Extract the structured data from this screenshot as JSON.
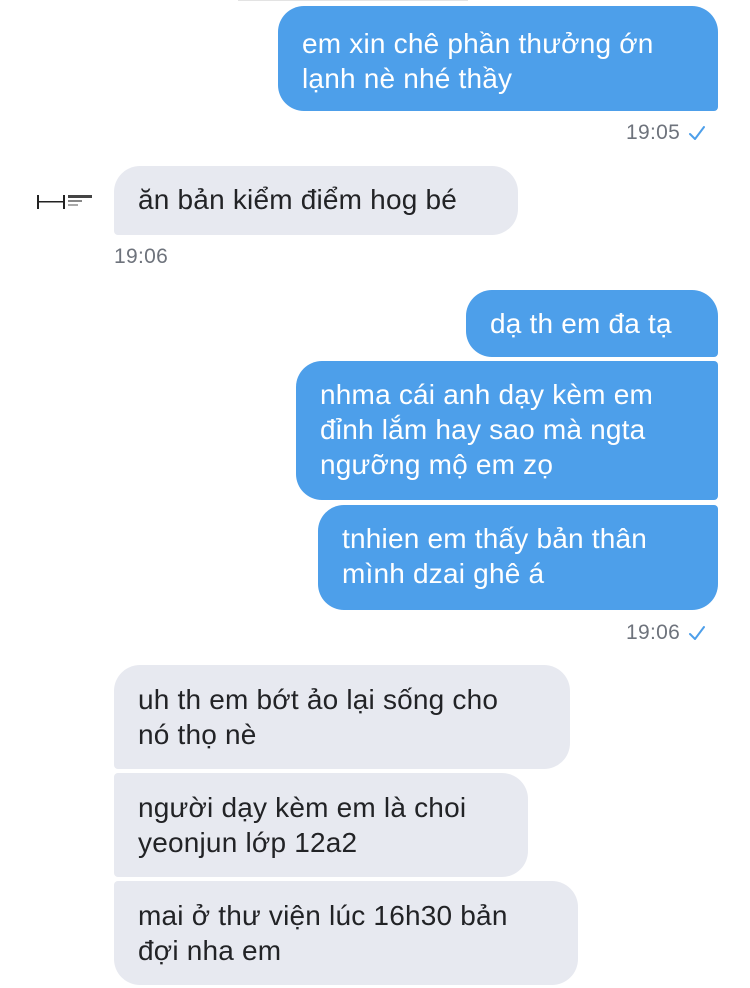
{
  "conversation": {
    "messages": [
      {
        "side": "out",
        "text": "em xin chê phần thưởng ớn\nlạnh nè nhé thầy"
      },
      {
        "side": "in",
        "text": "ăn bản kiểm điểm hog bé"
      },
      {
        "side": "out",
        "text": "dạ th em đa tạ"
      },
      {
        "side": "out",
        "text": "nhma cái anh dạy kèm em\nđỉnh lắm hay sao mà ngta\nngưỡng mộ em zọ"
      },
      {
        "side": "out",
        "text": "tnhien em thấy bản thân\nmình dzai ghê á"
      },
      {
        "side": "in",
        "text": "uh th em bớt ảo lại sống cho\nnó thọ nè"
      },
      {
        "side": "in",
        "text": "người dạy kèm em là choi\nyeonjun lớp 12a2"
      },
      {
        "side": "in",
        "text": "mai ở thư viện lúc 16h30 bản\nđợi nha em"
      }
    ],
    "timestamps": [
      "19:05",
      "19:06",
      "19:06"
    ],
    "avatar_text": "HYBE",
    "colors": {
      "outgoing_bubble": "#4d9fea",
      "incoming_bubble": "#e7e9f0",
      "timestamp": "#6e737c",
      "read_check": "#4d9fea"
    },
    "icons": {
      "read_receipt": "check-icon",
      "avatar": "hybe-logo-avatar"
    }
  }
}
